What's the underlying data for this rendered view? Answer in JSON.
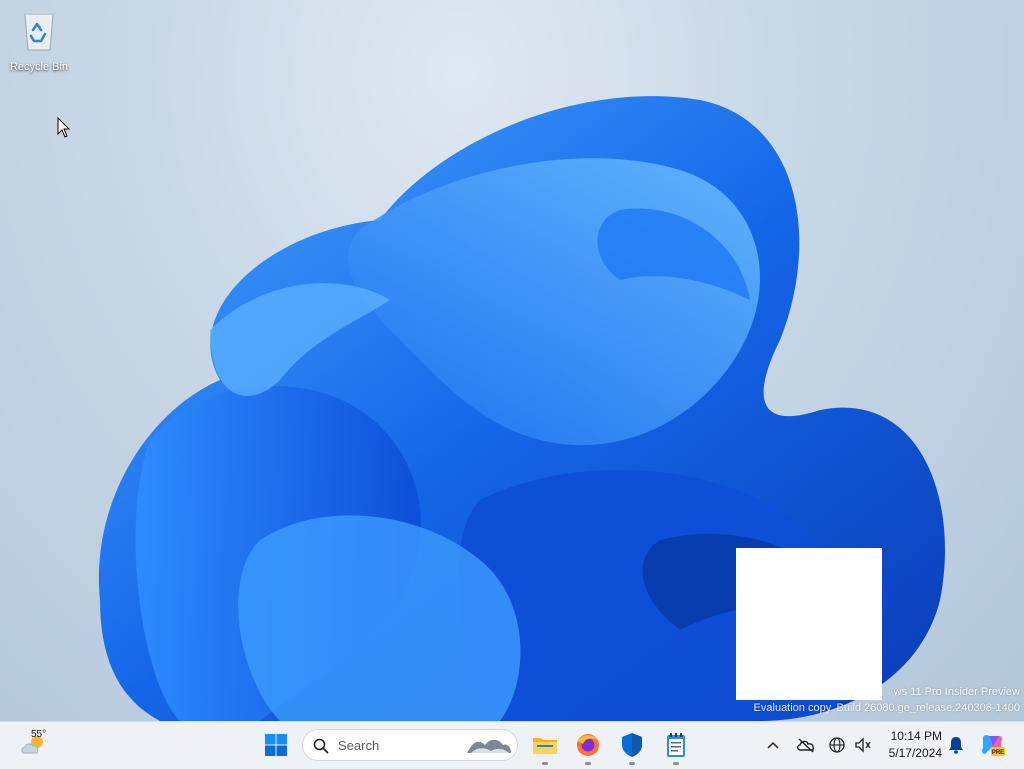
{
  "desktop": {
    "icons": [
      {
        "label": "Recycle Bin",
        "icon": "recycle-bin-icon"
      }
    ],
    "watermark": {
      "line1": "ws 11 Pro Insider Preview",
      "line2": "Evaluation copy. Build 26080.ge_release.240308-1400"
    }
  },
  "taskbar": {
    "weather": {
      "temperature": "55°",
      "icon": "partly-cloudy-icon"
    },
    "start": {
      "icon": "windows-logo-icon"
    },
    "search": {
      "placeholder": "Search",
      "icon": "search-icon"
    },
    "pinned_apps": [
      {
        "name": "File Explorer",
        "icon": "folder-icon"
      },
      {
        "name": "Firefox",
        "icon": "firefox-icon"
      },
      {
        "name": "Windows Security",
        "icon": "shield-icon"
      },
      {
        "name": "Notepad",
        "icon": "notepad-icon"
      }
    ],
    "tray": {
      "icons": [
        "chevron-up-icon",
        "onedrive-icon",
        "network-icon",
        "volume-icon",
        "bell-icon",
        "copilot-icon"
      ],
      "copilot_badge": "PRE",
      "time": "10:14 PM",
      "date": "5/17/2024"
    }
  },
  "colors": {
    "accent": "#0a6bd6",
    "taskbar_bg": "#eef1f5",
    "desktop_bg": "#c9d8e6"
  }
}
